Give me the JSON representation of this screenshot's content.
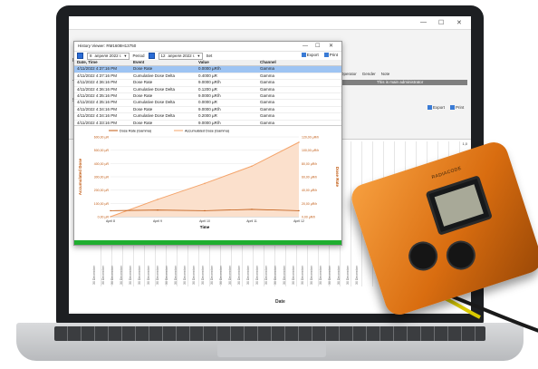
{
  "background_app": {
    "column_headers": [
      "Operator",
      "Gender",
      "Note"
    ],
    "selected_row_note": "This is main administrator",
    "toolbar": {
      "export": "Export",
      "print": "Print"
    },
    "left_tags": [
      "Pr",
      "Ty",
      "Sa",
      "uro"
    ],
    "window_controls": [
      "—",
      "☐",
      "✕"
    ],
    "date_ticks": [
      "30 December",
      "30 December",
      "30 December",
      "30 December",
      "30 December",
      "30 December",
      "30 December",
      "30 December",
      "30 December",
      "30 December",
      "30 December",
      "30 December",
      "30 December",
      "30 December",
      "30 December",
      "30 December",
      "30 December",
      "30 December",
      "30 December",
      "30 December",
      "30 December",
      "30 December",
      "30 December",
      "30 December",
      "30 December",
      "30 December",
      "30 December",
      "30 December",
      "30 December",
      "30 December"
    ],
    "axis_label": "Date",
    "right_ticks": [
      "1,0",
      "1,0",
      "1,0"
    ]
  },
  "viewer": {
    "title": "History Viewer: RM1608H13750",
    "window_controls": [
      "—",
      "☐",
      "✕"
    ],
    "toolbar": {
      "from_day": "8",
      "from_month_year": "апреля 2022 г.",
      "period_label": "Period",
      "to_day": "12",
      "to_month_year": "апреля 2022 г.",
      "set_label": "Set",
      "export_label": "Export",
      "print_label": "Print"
    },
    "columns": [
      "Date, Time",
      "Event",
      "Value",
      "Channel"
    ],
    "rows": [
      {
        "dt": "4/11/2022 4:37:16 PM",
        "event": "Dose Rate",
        "value": "0.0000 µR/h",
        "channel": "Gamma"
      },
      {
        "dt": "4/11/2022 4:37:16 PM",
        "event": "Cumulative Dose Delta",
        "value": "0.4000 µR",
        "channel": "Gamma"
      },
      {
        "dt": "4/11/2022 4:36:16 PM",
        "event": "Dose Rate",
        "value": "9.0000 µR/h",
        "channel": "Gamma"
      },
      {
        "dt": "4/11/2022 4:36:16 PM",
        "event": "Cumulative Dose Delta",
        "value": "0.1200 µR",
        "channel": "Gamma"
      },
      {
        "dt": "4/11/2022 4:35:16 PM",
        "event": "Dose Rate",
        "value": "9.0000 µR/h",
        "channel": "Gamma"
      },
      {
        "dt": "4/11/2022 4:35:16 PM",
        "event": "Cumulative Dose Delta",
        "value": "0.0000 µR",
        "channel": "Gamma"
      },
      {
        "dt": "4/11/2022 4:34:16 PM",
        "event": "Dose Rate",
        "value": "9.0000 µR/h",
        "channel": "Gamma"
      },
      {
        "dt": "4/11/2022 4:34:16 PM",
        "event": "Cumulative Dose Delta",
        "value": "0.2000 µR",
        "channel": "Gamma"
      },
      {
        "dt": "4/11/2022 4:33:16 PM",
        "event": "Dose Rate",
        "value": "9.0000 µR/h",
        "channel": "Gamma"
      },
      {
        "dt": "4/11/2022 4:33:16 PM",
        "event": "Cumulative Dose Delta",
        "value": "0.0400 µR",
        "channel": "Gamma"
      }
    ],
    "selected_row": 0
  },
  "chart_data": {
    "type": "area",
    "legend": [
      "Dose Rate (Gamma)",
      "Accumulated Dose (Gamma)"
    ],
    "legend_placement": "top-left",
    "x": [
      "April 8",
      "April 9",
      "April 10",
      "April 11",
      "April 12"
    ],
    "xlabel": "Time",
    "ylabel_left": "Accumulated Dose",
    "ylabel_right": "Dose Rate",
    "y_left_ticks": [
      "0,00 µR",
      "100,00 µR",
      "200,00 µR",
      "300,00 µR",
      "400,00 µR",
      "500,00 µR",
      "600,00 µR"
    ],
    "y_right_ticks": [
      "0,00 µR/h",
      "20,00 µR/h",
      "40,00 µR/h",
      "60,00 µR/h",
      "80,00 µR/h",
      "100,00 µR/h",
      "120,00 µR/h"
    ],
    "ylim_left": [
      0,
      600
    ],
    "ylim_right": [
      0,
      120
    ],
    "series": [
      {
        "name": "Accumulated Dose (Gamma)",
        "type": "area",
        "values": [
          0,
          130,
          250,
          380,
          560
        ]
      },
      {
        "name": "Dose Rate (Gamma)",
        "type": "line",
        "values": [
          9,
          10,
          9,
          11,
          9
        ]
      }
    ],
    "colors": {
      "accumulated": "#f4a46b",
      "accumulated_fill": "#fbe0cc",
      "dose_rate": "#c15a12",
      "grid": "#e6e6e6"
    }
  },
  "device": {
    "brand": "RADIACODE"
  }
}
